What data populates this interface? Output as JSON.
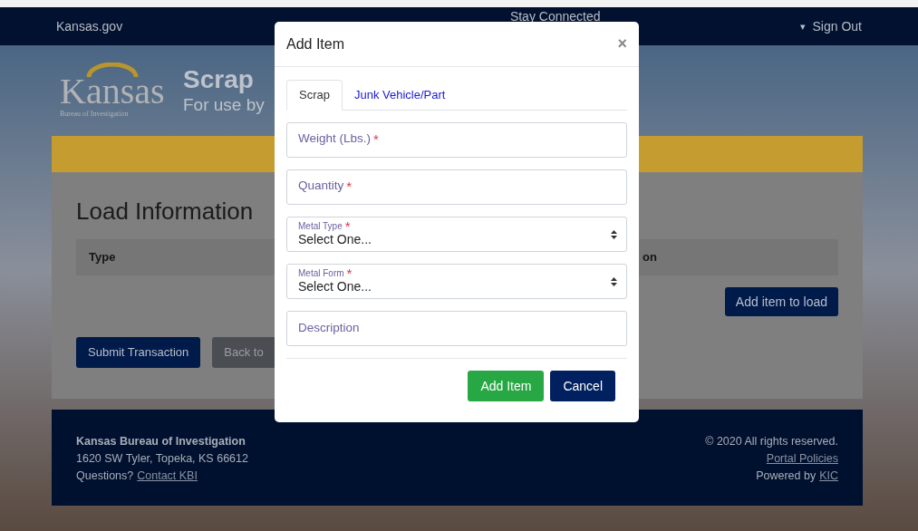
{
  "top_nav": {
    "site": "Kansas.gov",
    "stay_connected": "Stay Connected",
    "menu_caret": "▾",
    "sign_out": "Sign Out"
  },
  "header": {
    "logo": {
      "word": "Kansas",
      "subtitle": "Bureau of Investigation"
    },
    "title": "Scrap",
    "subtitle": "For use by"
  },
  "load_information": {
    "heading": "Load Information",
    "table": {
      "columns": [
        "Type",
        "on"
      ]
    },
    "add_button": "Add item to load",
    "buttons": [
      {
        "label": "Submit Transaction",
        "kind": "primary"
      },
      {
        "label": "Back to",
        "kind": "secondary"
      }
    ]
  },
  "footer": {
    "organization": "Kansas Bureau of Investigation",
    "address": "1620 SW Tyler, Topeka, KS 66612",
    "questions": "Questions?",
    "contact_link": "Contact KBI",
    "copyright": "© 2020 All rights reserved.",
    "policies_link": "Portal Policies",
    "powered_by": "Powered by",
    "powered_link": "KIC"
  },
  "modal": {
    "title": "Add Item",
    "close": "×",
    "tabs": [
      {
        "label": "Scrap",
        "selected": true
      },
      {
        "label": "Junk Vehicle/Part",
        "selected": false
      }
    ],
    "fields": [
      {
        "kind": "input",
        "label": "Weight (Lbs.)",
        "required_mark": "*"
      },
      {
        "kind": "input",
        "label": "Quantity",
        "required_mark": "*"
      },
      {
        "kind": "select",
        "label": "Metal Type",
        "required_mark": "*",
        "value": "Select One..."
      },
      {
        "kind": "select",
        "label": "Metal Form",
        "required_mark": "*",
        "value": "Select One..."
      },
      {
        "kind": "input",
        "label": "Description"
      }
    ],
    "buttons": [
      {
        "label": "Add Item",
        "kind": "success"
      },
      {
        "label": "Cancel",
        "kind": "primary"
      }
    ]
  }
}
